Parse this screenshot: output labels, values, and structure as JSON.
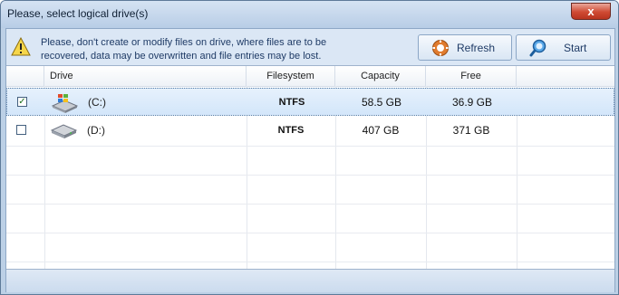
{
  "window": {
    "title": "Please, select logical drive(s)",
    "close_label": "x"
  },
  "warning": {
    "icon": "warning-icon",
    "text": "Please, don't create or modify files on drive, where files are to be recovered, data may be overwritten and file entries may be lost."
  },
  "toolbar": {
    "refresh_label": "Refresh",
    "refresh_icon": "gear-icon",
    "start_label": "Start",
    "start_icon": "magnifier-icon"
  },
  "table": {
    "columns": [
      "Drive",
      "Filesystem",
      "Capacity",
      "Free"
    ],
    "rows": [
      {
        "checked": true,
        "icon": "windows-drive-icon",
        "drive": "(C:)",
        "filesystem": "NTFS",
        "capacity": "58.5 GB",
        "free": "36.9 GB",
        "selected": true
      },
      {
        "checked": false,
        "icon": "hard-drive-icon",
        "drive": "(D:)",
        "filesystem": "NTFS",
        "capacity": "407 GB",
        "free": "371 GB",
        "selected": false
      }
    ]
  },
  "colors": {
    "accent": "#bcd0e6",
    "selection": "#d3e6fa",
    "close_button": "#cf4a33"
  }
}
